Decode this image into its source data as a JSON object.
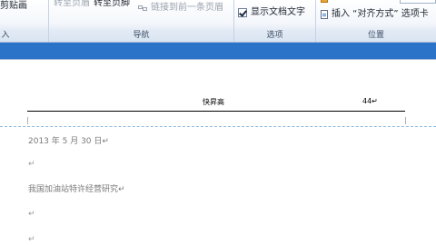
{
  "ribbon": {
    "paste_label": "剪贴画",
    "goto_header_label": "转至页眉",
    "goto_footer_label": "转至页脚",
    "link_previous_label": "链接到前一条页眉",
    "show_doc_text_label": "显示文档文字",
    "insert_align_tab_label": "插入 “对齐方式” 选项卡",
    "group_insert_label": "入",
    "group_nav_label": "导航",
    "group_options_label": "选项",
    "group_position_label": "位置",
    "show_doc_text_checked": true
  },
  "document": {
    "header_title": "快昇高",
    "header_page": "44↵",
    "date_line": "2013 年 5 月 30 日↵",
    "paragraph_mark_1": "↵",
    "title_line": "我国加油站特许经营研究↵",
    "paragraph_mark_2": "↵",
    "paragraph_mark_3": "↵"
  },
  "colors": {
    "ribbon_band": "#2b73c9",
    "header_rule": "#000000",
    "body_text": "#7a7a7a"
  }
}
